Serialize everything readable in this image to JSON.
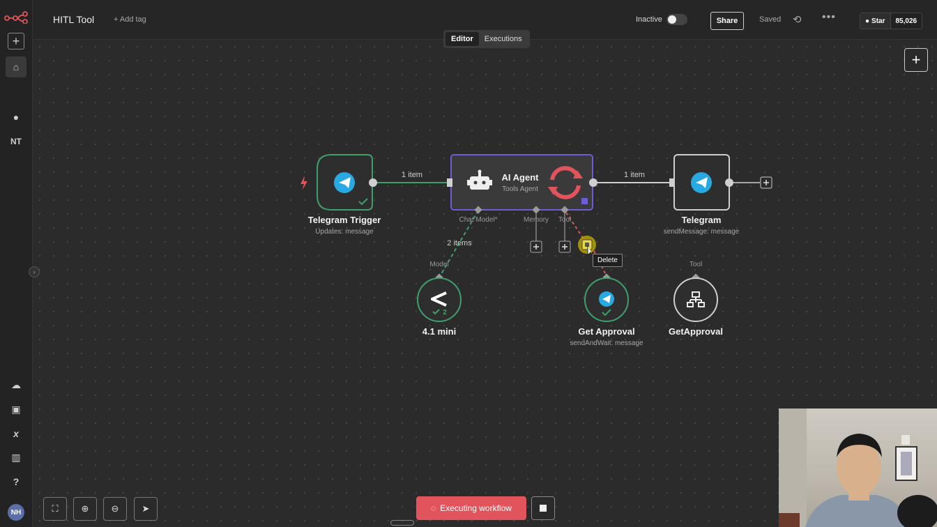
{
  "header": {
    "workflow_title": "HITL Tool",
    "add_tag": "+ Add tag",
    "status_label": "Inactive",
    "share_label": "Share",
    "saved_label": "Saved",
    "github_star": "Star",
    "github_count": "85,026"
  },
  "tabs": [
    {
      "label": "Editor",
      "active": true
    },
    {
      "label": "Executions",
      "active": false
    }
  ],
  "sidebar": {
    "workspace_initials": "NT",
    "avatar_initials": "NH"
  },
  "nodes": {
    "telegram_trigger": {
      "title": "Telegram Trigger",
      "subtitle": "Updates: message"
    },
    "ai_agent": {
      "title": "AI Agent",
      "subtitle": "Tools Agent"
    },
    "telegram": {
      "title": "Telegram",
      "subtitle": "sendMessage: message"
    },
    "model": {
      "title": "4.1 mini",
      "badge": "2"
    },
    "get_approval": {
      "title": "Get Approval",
      "subtitle": "sendAndWait: message"
    },
    "get_approval_tool": {
      "title": "GetApproval"
    }
  },
  "ports": {
    "chat_model": "Chat Model*",
    "memory": "Memory",
    "tool": "Tool",
    "model": "Model",
    "tool_2": "Tool"
  },
  "edges": {
    "trigger_to_agent": "1 item",
    "agent_to_telegram": "1 item",
    "model_items": "2 items"
  },
  "tooltip": "Delete",
  "bottom": {
    "execute_label": "Executing workflow"
  },
  "colors": {
    "success": "#3fa06b",
    "accent_red": "#e2545b",
    "telegram_blue": "#29a9e1",
    "agent_border": "#6b5fd3"
  }
}
